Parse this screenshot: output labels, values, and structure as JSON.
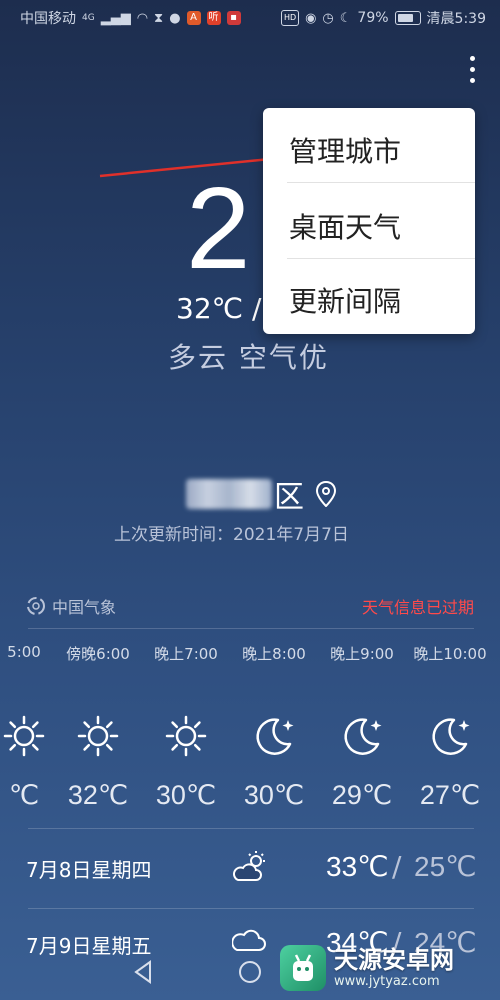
{
  "status_bar": {
    "carrier": "中国移动",
    "network": "4G",
    "battery": "79%",
    "time": "清晨5:39",
    "hd": "HD"
  },
  "current": {
    "temp_visible": "2",
    "range": "32℃ /",
    "condition": "多云 空气优"
  },
  "menu": {
    "items": [
      "管理城市",
      "桌面天气",
      "更新间隔"
    ]
  },
  "location": {
    "suffix": "区",
    "updated": "上次更新时间：2021年7月7日"
  },
  "source": {
    "name": "中国气象",
    "expired": "天气信息已过期"
  },
  "hourly": [
    {
      "label": "5:00",
      "icon": "sun-icon",
      "temp": "℃"
    },
    {
      "label": "傍晚6:00",
      "icon": "sun-icon",
      "temp": "32℃"
    },
    {
      "label": "晚上7:00",
      "icon": "sun-icon",
      "temp": "30℃"
    },
    {
      "label": "晚上8:00",
      "icon": "moon-icon",
      "temp": "30℃"
    },
    {
      "label": "晚上9:00",
      "icon": "moon-icon",
      "temp": "29℃"
    },
    {
      "label": "晚上10:00",
      "icon": "moon-icon",
      "temp": "27℃"
    }
  ],
  "daily": [
    {
      "date": "7月8日星期四",
      "icon": "partly-sunny-icon",
      "high": "33℃",
      "low": "25℃"
    },
    {
      "date": "7月9日星期五",
      "icon": "cloud-icon",
      "high": "34℃",
      "low": "24℃"
    }
  ],
  "watermark": {
    "title": "天源安卓网",
    "url": "www.jytyaz.com"
  },
  "colors": {
    "accent_red": "#ff4a4a",
    "background_top": "#1d2d4e",
    "background_bottom": "#3a5f93"
  }
}
